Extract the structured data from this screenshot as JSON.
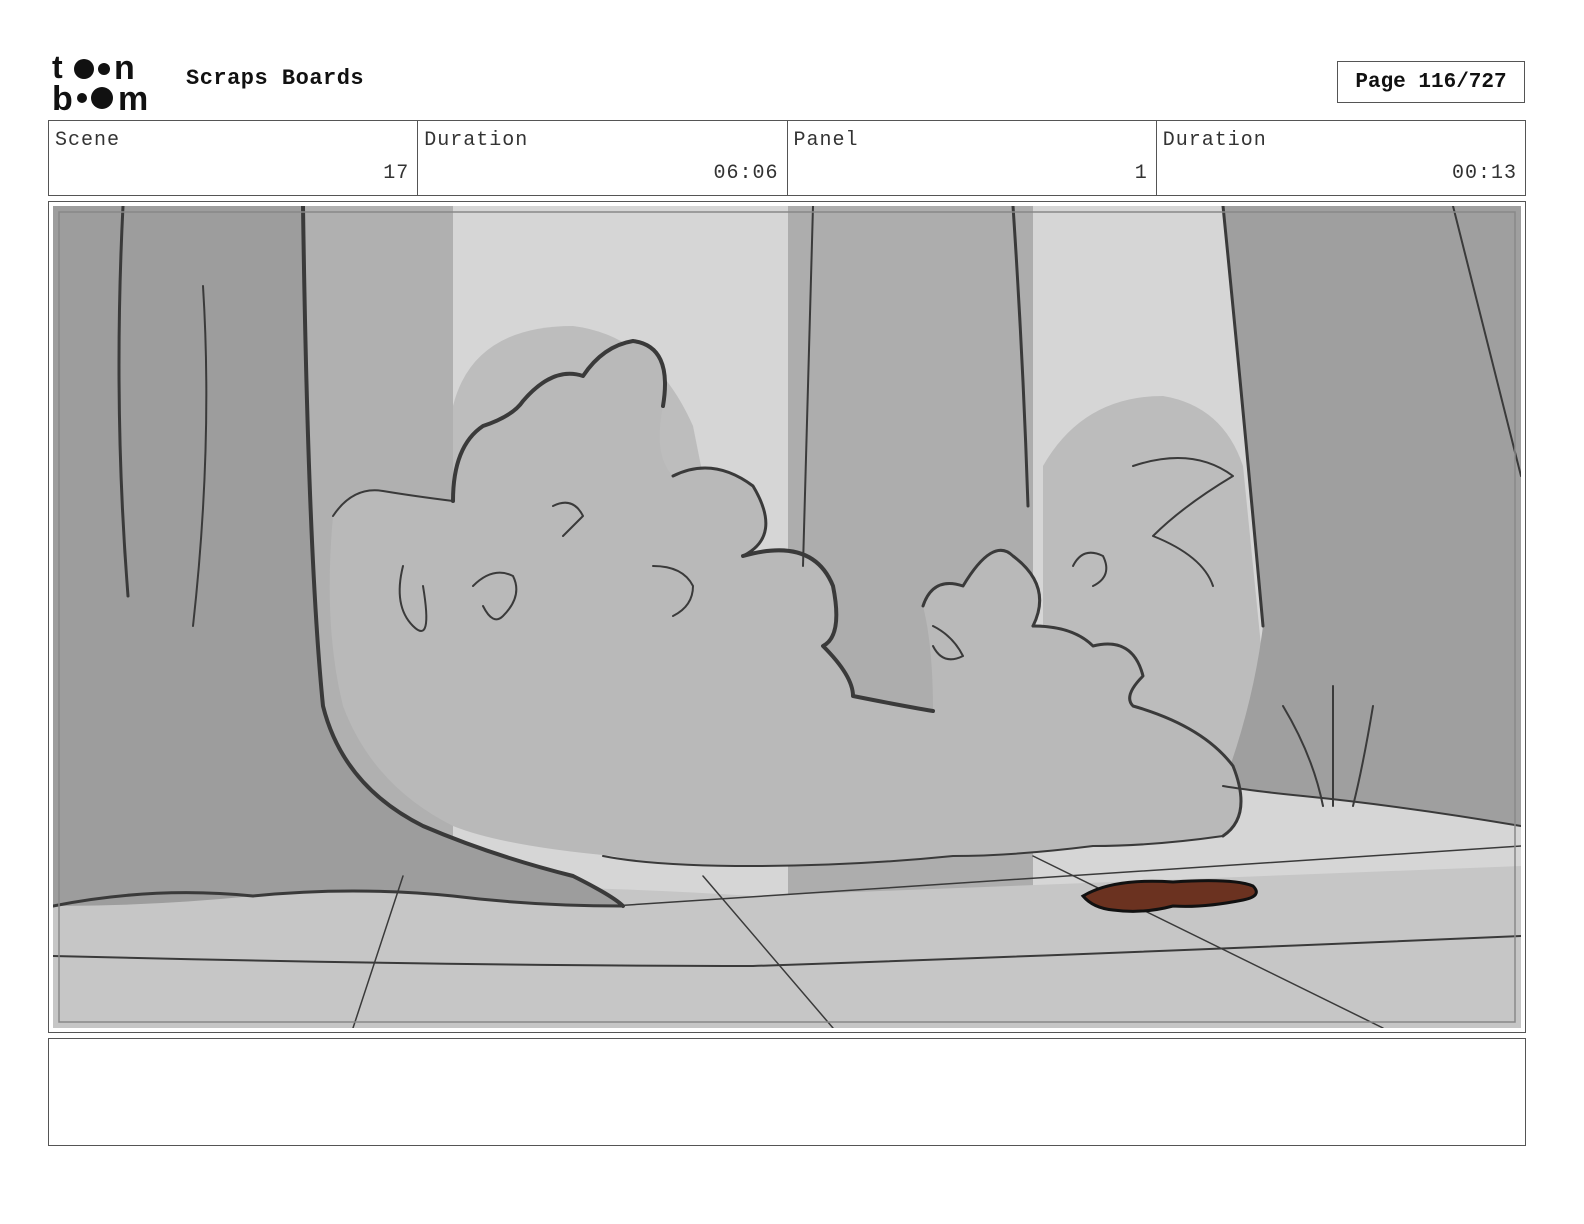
{
  "header": {
    "logo_text_top": "toon",
    "logo_text_bottom": "boom",
    "title": "Scraps Boards",
    "page": "Page 116/727"
  },
  "info": {
    "scene_label": "Scene",
    "scene_value": "17",
    "scene_duration_label": "Duration",
    "scene_duration_value": "06:06",
    "panel_label": "Panel",
    "panel_value": "1",
    "panel_duration_label": "Duration",
    "panel_duration_value": "00:13"
  },
  "panel": {
    "description": "",
    "colors": {
      "sky": "#d6d6d6",
      "far_trees": "#b3b3b3",
      "near_trees": "#9a9a9a",
      "bushes": "#b8b8b8",
      "ground": "#c4c4c4",
      "leaf": "#6b3220",
      "line": "#3a3a3a"
    }
  },
  "notes": {
    "text": ""
  }
}
